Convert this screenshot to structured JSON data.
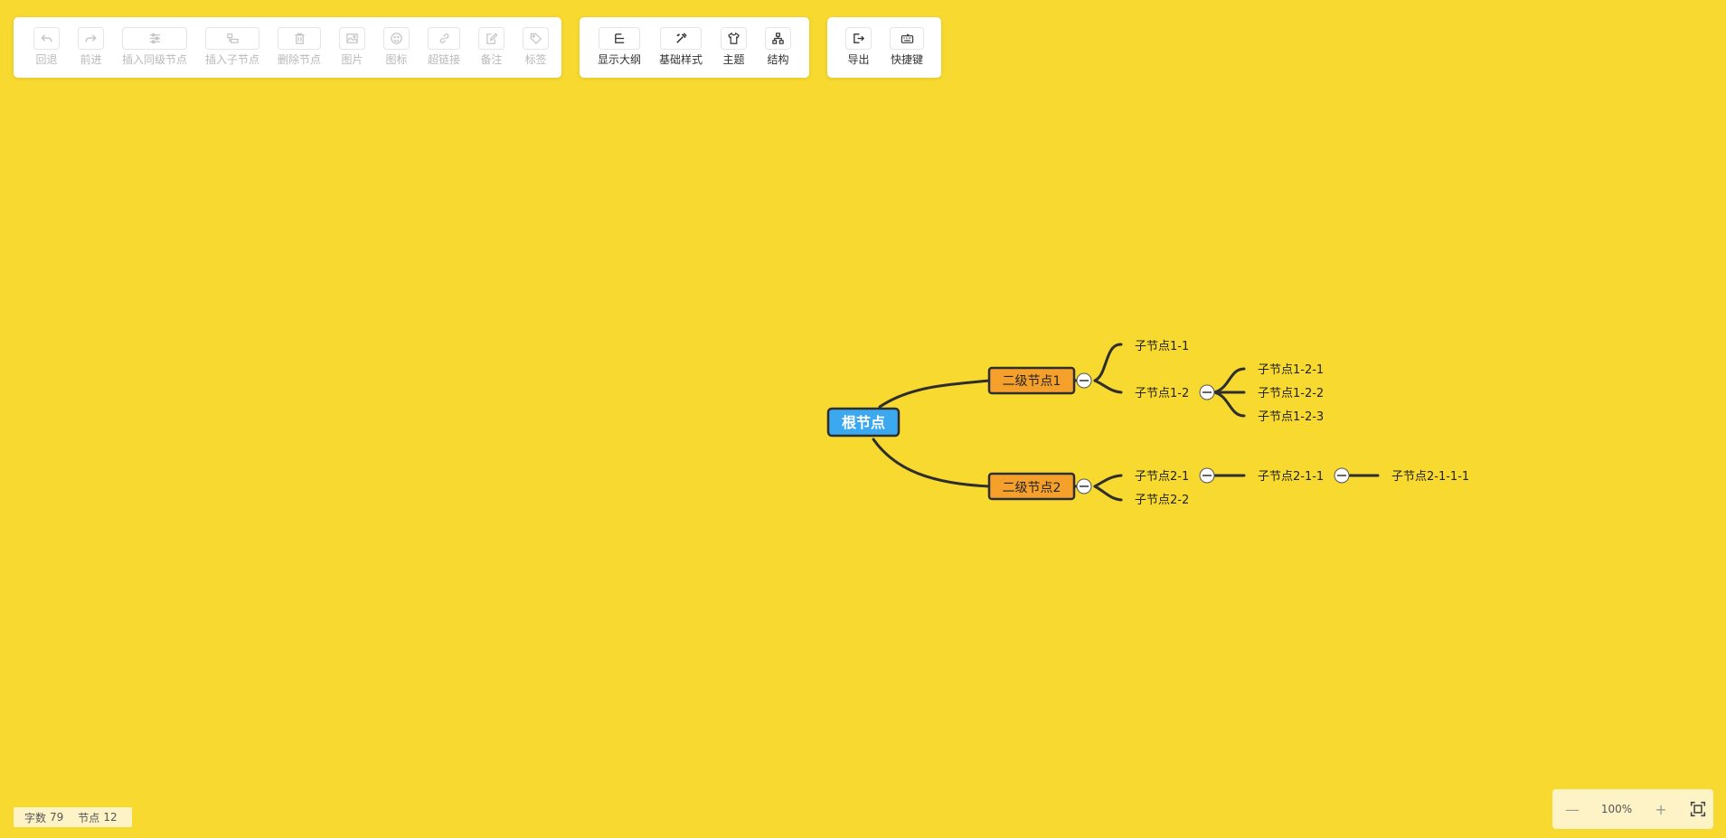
{
  "toolbar": {
    "edit_group": [
      {
        "label": "回退",
        "icon": "undo-icon",
        "enabled": false
      },
      {
        "label": "前进",
        "icon": "redo-icon",
        "enabled": false
      },
      {
        "label": "插入同级节点",
        "icon": "sibling-node-icon",
        "enabled": false
      },
      {
        "label": "插入子节点",
        "icon": "child-node-icon",
        "enabled": false
      },
      {
        "label": "删除节点",
        "icon": "trash-icon",
        "enabled": false
      },
      {
        "label": "图片",
        "icon": "image-icon",
        "enabled": false
      },
      {
        "label": "图标",
        "icon": "emoji-icon",
        "enabled": false
      },
      {
        "label": "超链接",
        "icon": "link-icon",
        "enabled": false
      },
      {
        "label": "备注",
        "icon": "note-icon",
        "enabled": false
      },
      {
        "label": "标签",
        "icon": "tag-icon",
        "enabled": false
      }
    ],
    "view_group": [
      {
        "label": "显示大纲",
        "icon": "outline-icon",
        "enabled": true
      },
      {
        "label": "基础样式",
        "icon": "style-icon",
        "enabled": true
      },
      {
        "label": "主题",
        "icon": "theme-shirt-icon",
        "enabled": true
      },
      {
        "label": "结构",
        "icon": "structure-icon",
        "enabled": true
      }
    ],
    "misc_group": [
      {
        "label": "导出",
        "icon": "export-icon",
        "enabled": true
      },
      {
        "label": "快捷键",
        "icon": "keyboard-icon",
        "enabled": true
      }
    ]
  },
  "mindmap": {
    "root": "根节点",
    "level2": [
      "二级节点1",
      "二级节点2"
    ],
    "children": {
      "n1_1": "子节点1-1",
      "n1_2": "子节点1-2",
      "n1_2_1": "子节点1-2-1",
      "n1_2_2": "子节点1-2-2",
      "n1_2_3": "子节点1-2-3",
      "n2_1": "子节点2-1",
      "n2_2": "子节点2-2",
      "n2_1_1": "子节点2-1-1",
      "n2_1_1_1": "子节点2-1-1-1"
    }
  },
  "status": {
    "words_label": "字数",
    "words_value": "79",
    "nodes_label": "节点",
    "nodes_value": "12"
  },
  "zoom": {
    "minus": "—",
    "value": "100%",
    "plus": "+"
  },
  "colors": {
    "background": "#f7d92f",
    "root_fill": "#3ca8f0",
    "level2_fill": "#f6a02c",
    "line": "#2e2e2e"
  }
}
